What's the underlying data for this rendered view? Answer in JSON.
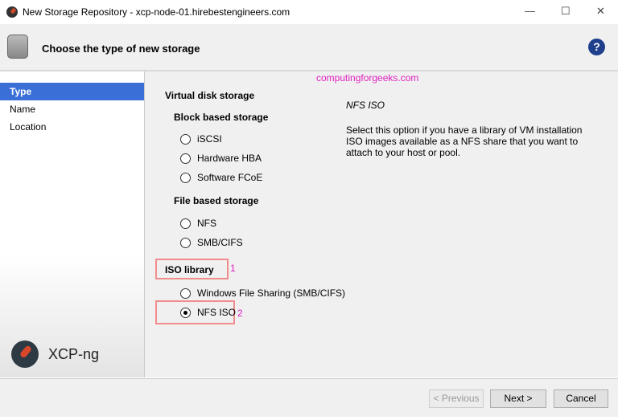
{
  "window": {
    "title": "New Storage Repository - xcp-node-01.hirebestengineers.com",
    "minimize": "—",
    "maximize": "☐",
    "close": "✕"
  },
  "header": {
    "title": "Choose the type of new storage",
    "help": "?"
  },
  "sidebar": {
    "items": [
      {
        "label": "Type"
      },
      {
        "label": "Name"
      },
      {
        "label": "Location"
      }
    ],
    "brand": "XCP-ng"
  },
  "watermark": "computingforgeeks.com",
  "options": {
    "virtual_disk": "Virtual disk storage",
    "block": "Block based storage",
    "block_items": [
      "iSCSI",
      "Hardware HBA",
      "Software FCoE"
    ],
    "file": "File based storage",
    "file_items": [
      "NFS",
      "SMB/CIFS"
    ],
    "iso": "ISO library",
    "iso_items": [
      "Windows File Sharing (SMB/CIFS)",
      "NFS ISO"
    ],
    "selected": "NFS ISO"
  },
  "annotations": [
    "1",
    "2"
  ],
  "description": {
    "title": "NFS ISO",
    "text": "Select this option if you have a library of VM installation ISO images available as a NFS share that you want to attach to your host or pool."
  },
  "footer": {
    "previous": "< Previous",
    "next": "Next >",
    "cancel": "Cancel"
  }
}
